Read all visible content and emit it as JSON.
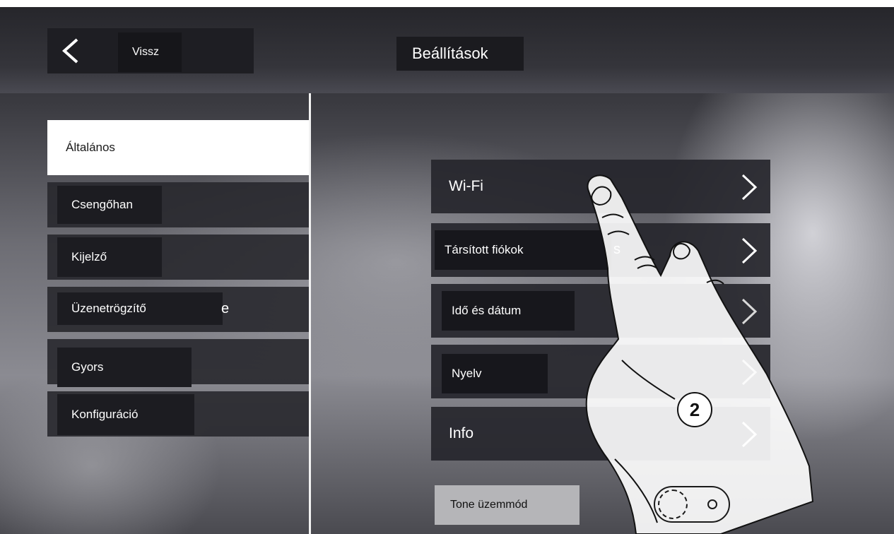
{
  "header": {
    "back_label": "Vissz",
    "title": "Beállítások"
  },
  "sidebar": {
    "items": [
      {
        "label": "Általános",
        "active": true
      },
      {
        "label": "Csengőhan",
        "active": false
      },
      {
        "label": "Kijelző",
        "active": false
      },
      {
        "label": "Üzenetrögzítő",
        "active": false,
        "trailing_text": "e"
      },
      {
        "label": "Gyors",
        "active": false
      },
      {
        "label": "Konfiguráció",
        "active": false
      }
    ]
  },
  "main": {
    "menu": [
      {
        "label": "Wi-Fi"
      },
      {
        "label": "Társított fiókok",
        "trailing_text": "s"
      },
      {
        "label": "Idő és dátum"
      },
      {
        "label": "Nyelv"
      },
      {
        "label": "Info"
      }
    ],
    "toggle": {
      "label": "Tone üzemmód",
      "on": false
    }
  },
  "overlay": {
    "step_number": "2"
  },
  "colors": {
    "panel_dark": "#26262c",
    "active_item_bg": "#ffffff",
    "text_light": "#ffffff",
    "label_box": "#17171c",
    "tone_label_bg": "#b5b5b8"
  }
}
